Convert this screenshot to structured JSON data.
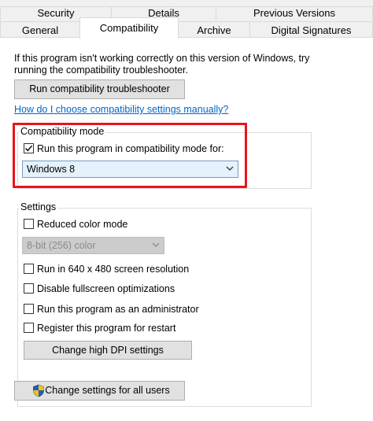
{
  "tabs": {
    "row1": [
      "Security",
      "Details",
      "Previous Versions"
    ],
    "row2": [
      "General",
      "Compatibility",
      "Archive",
      "Digital Signatures"
    ]
  },
  "intro": {
    "line1": "If this program isn't working correctly on this version of Windows, try",
    "line2": "running the compatibility troubleshooter."
  },
  "troubleshooter_button": "Run compatibility troubleshooter",
  "help_link": "How do I choose compatibility settings manually?",
  "compat_mode": {
    "legend": "Compatibility mode",
    "checkbox_label": "Run this program in compatibility mode for:",
    "checked": true,
    "selected_os": "Windows 8"
  },
  "settings": {
    "legend": "Settings",
    "reduced_color": "Reduced color mode",
    "color_depth": "8-bit (256) color",
    "run_640": "Run in 640 x 480 screen resolution",
    "disable_fullscreen": "Disable fullscreen optimizations",
    "run_admin": "Run this program as an administrator",
    "register_restart": "Register this program for restart",
    "dpi_button": "Change high DPI settings"
  },
  "all_users_button": "Change settings for all users",
  "colors": {
    "highlight": "#e8141c",
    "link": "#0066cc",
    "select_bg": "#e5f1fb"
  },
  "icons": {
    "shield": "uac-shield-icon",
    "check": "checkmark-icon",
    "chevron": "chevron-down-icon"
  }
}
